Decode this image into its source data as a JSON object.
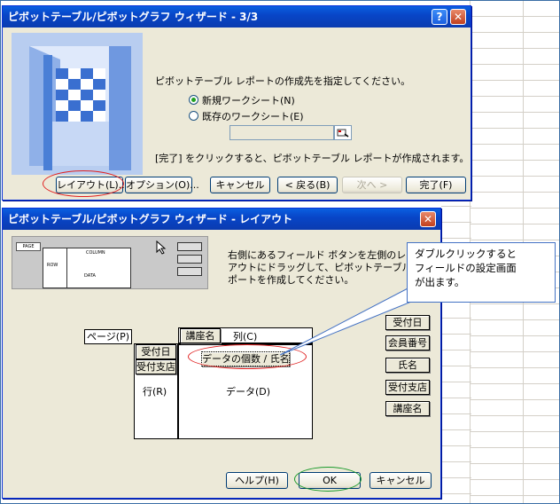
{
  "wizard1": {
    "title": "ピボットテーブル/ピボットグラフ ウィザード - 3/3",
    "prompt": "ピボットテーブル レポートの作成先を指定してください。",
    "radio_new": "新規ワークシート(N)",
    "radio_existing": "既存のワークシート(E)",
    "footer_note": "[完了] をクリックすると、ピボットテーブル レポートが作成されます。",
    "buttons": {
      "layout": "レイアウト(L)...",
      "options": "オプション(O)...",
      "cancel": "キャンセル",
      "back": "< 戻る(B)",
      "next": "次へ >",
      "finish": "完了(F)"
    },
    "help_glyph": "?",
    "close_glyph": "✕"
  },
  "wizard2": {
    "title": "ピボットテーブル/ピボットグラフ ウィザード - レイアウト",
    "close_glyph": "✕",
    "instructions": [
      "右側にあるフィールド ボタンを左側のレイ",
      "アウトにドラッグして、ピボットテーブル レ",
      "ポートを作成してください。"
    ],
    "areas": {
      "page": "ページ(P)",
      "column": "列(C)",
      "row": "行(R)",
      "data": "データ(D)"
    },
    "placed": {
      "col_field": "講座名",
      "row_field_1": "受付日",
      "row_field_2": "受付支店",
      "data_field": "データの個数 / 氏名"
    },
    "field_buttons": [
      "受付日",
      "会員番号",
      "氏名",
      "受付支店",
      "講座名"
    ],
    "buttons": {
      "help": "ヘルプ(H)",
      "ok": "OK",
      "cancel": "キャンセル"
    },
    "preview": {
      "page": "PAGE",
      "row": "ROW",
      "column": "COLUMN",
      "data": "DATA"
    }
  },
  "callout": {
    "lines": [
      "ダブルクリックすると",
      "フィールドの設定画面",
      "が出ます。"
    ]
  },
  "colors": {
    "title_blue": "#0a4fd6",
    "highlight_red": "#e02020",
    "highlight_green": "#1a9a2a",
    "callout_border": "#4472c4"
  }
}
